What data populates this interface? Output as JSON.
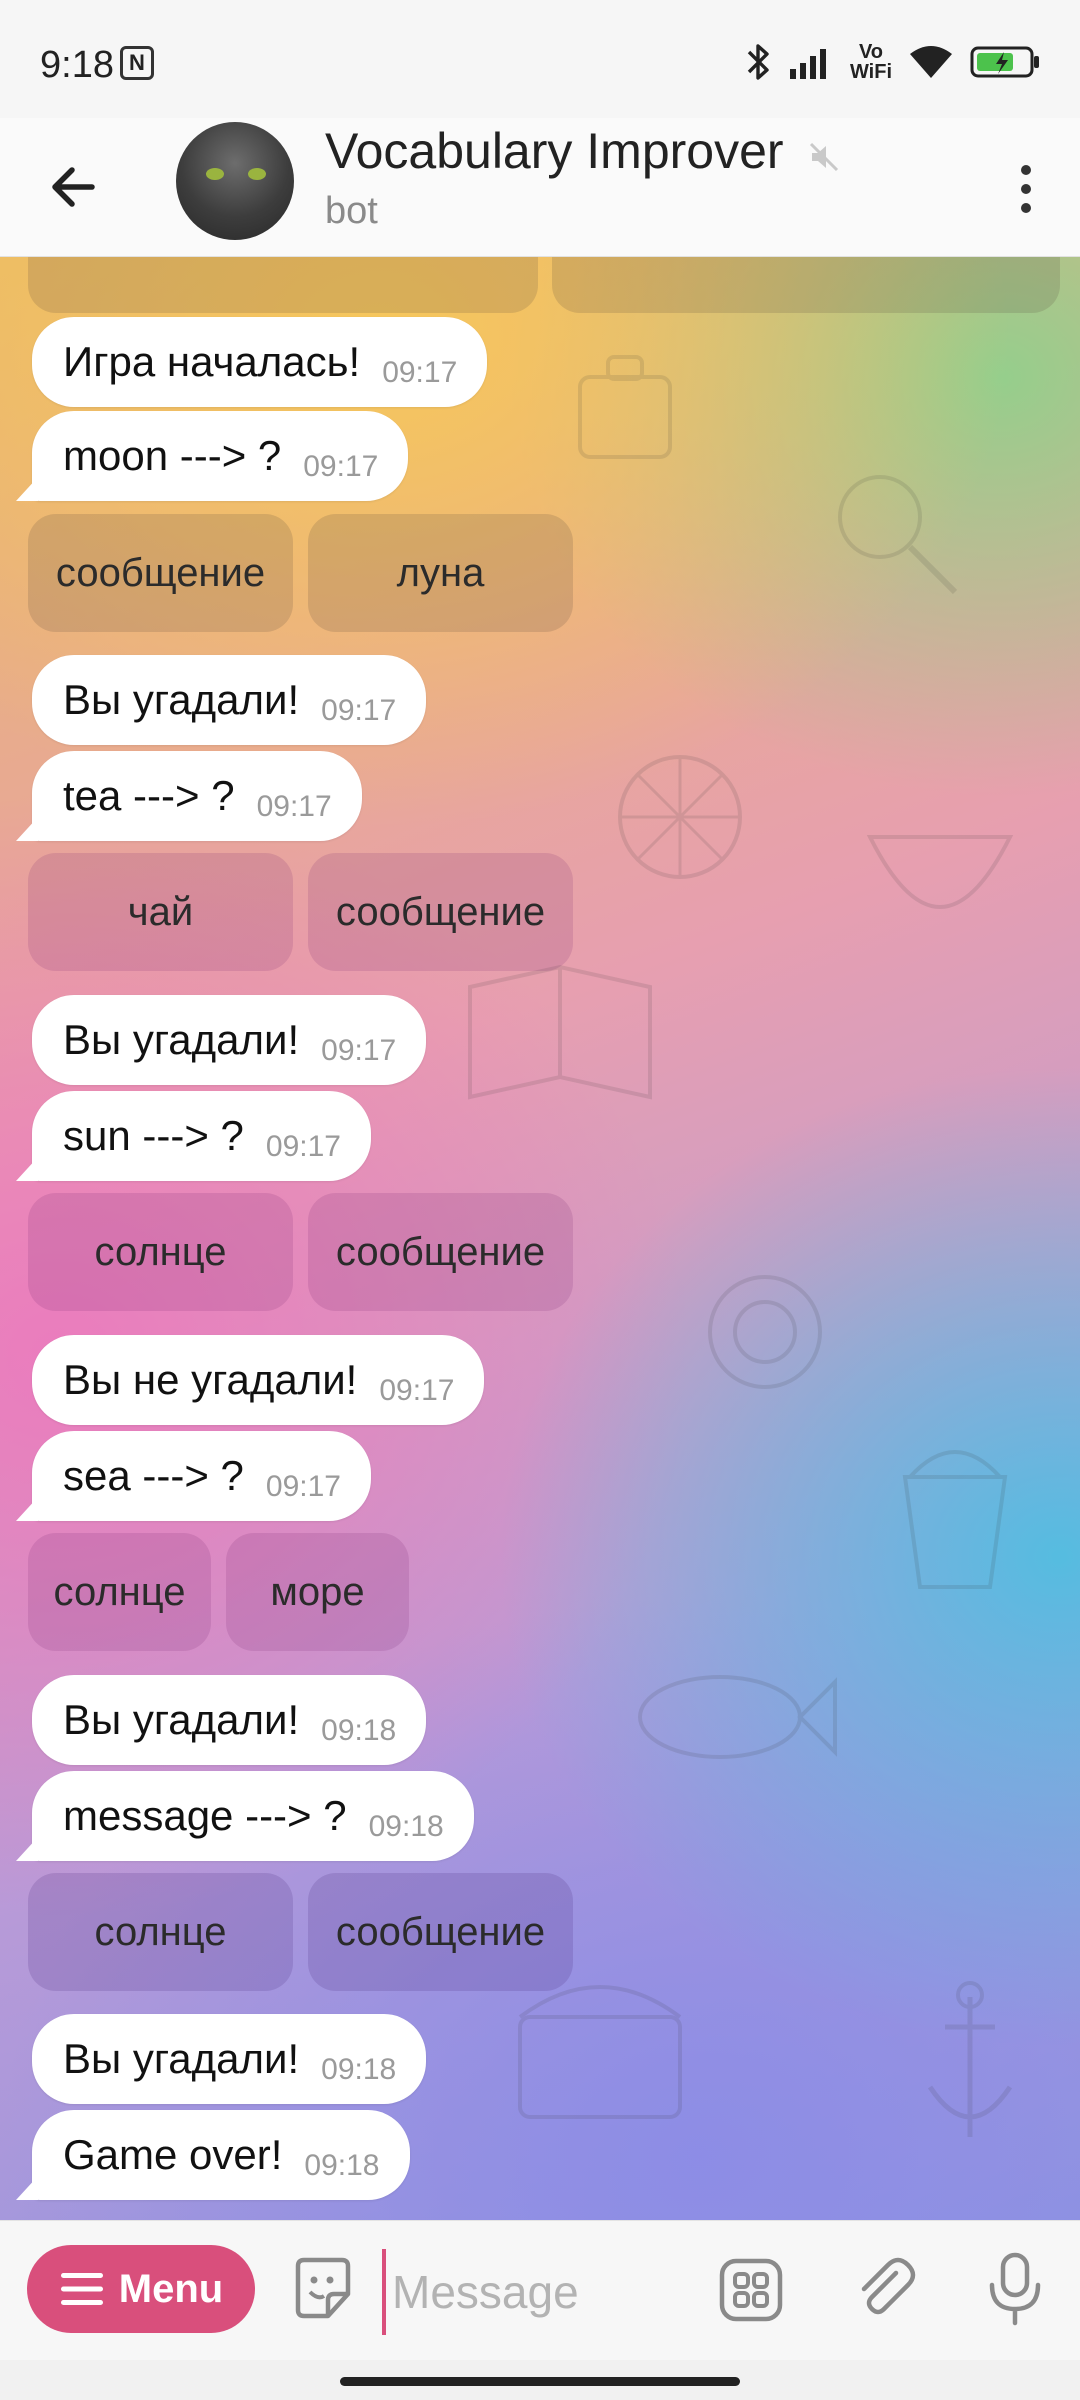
{
  "status_bar": {
    "time": "9:18",
    "nfc_label": "N",
    "volte_line1": "Vo",
    "volte_line2": "WiFi"
  },
  "header": {
    "title": "Vocabulary Improver",
    "subtitle": "bot"
  },
  "messages": [
    {
      "text": "Игра началась!",
      "time": "09:17"
    },
    {
      "text": "moon ---> ?",
      "time": "09:17"
    },
    {
      "text": "Вы угадали!",
      "time": "09:17"
    },
    {
      "text": "tea ---> ?",
      "time": "09:17"
    },
    {
      "text": "Вы угадали!",
      "time": "09:17"
    },
    {
      "text": "sun ---> ?",
      "time": "09:17"
    },
    {
      "text": "Вы не угадали!",
      "time": "09:17"
    },
    {
      "text": "sea ---> ?",
      "time": "09:17"
    },
    {
      "text": "Вы угадали!",
      "time": "09:18"
    },
    {
      "text": "message ---> ?",
      "time": "09:18"
    },
    {
      "text": "Вы угадали!",
      "time": "09:18"
    },
    {
      "text": "Game over!",
      "time": "09:18"
    }
  ],
  "keyboards": [
    [
      "сообщение",
      "луна"
    ],
    [
      "чай",
      "сообщение"
    ],
    [
      "солнце",
      "сообщение"
    ],
    [
      "солнце",
      "море"
    ],
    [
      "солнце",
      "сообщение"
    ]
  ],
  "input_bar": {
    "menu_label": "Menu",
    "placeholder": "Message"
  },
  "colors": {
    "accent": "#d94f7c",
    "bubble": "#ffffff",
    "time_text": "#9a9a9a"
  }
}
